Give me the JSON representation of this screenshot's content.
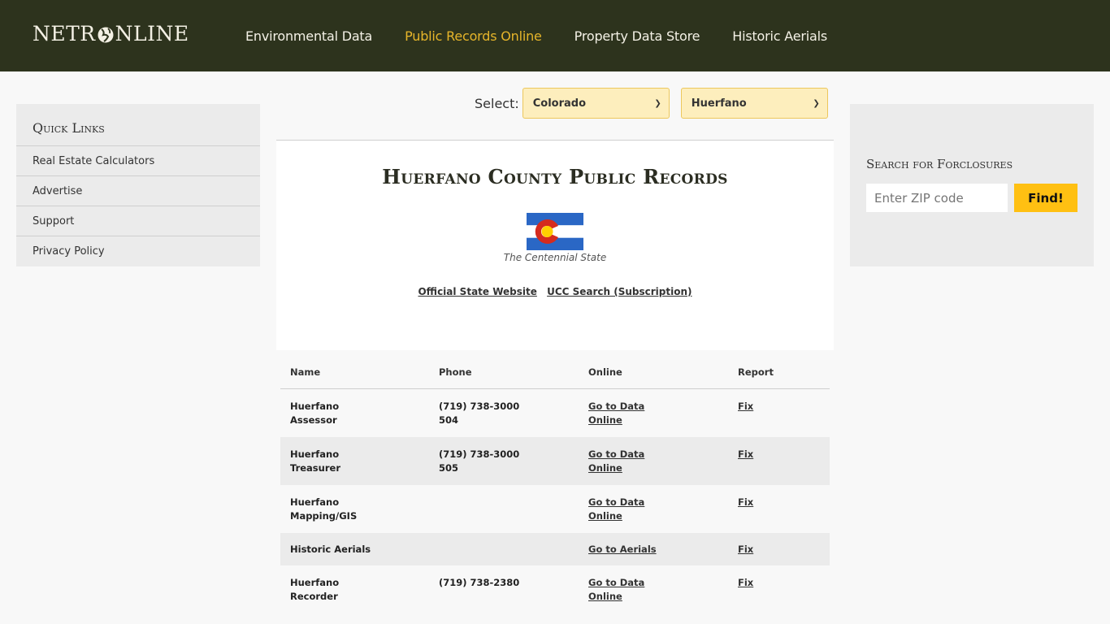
{
  "header": {
    "logo_left": "NETR",
    "logo_right": "NLINE",
    "nav": [
      {
        "label": "Environmental Data",
        "active": false
      },
      {
        "label": "Public Records Online",
        "active": true
      },
      {
        "label": "Property Data Store",
        "active": false
      },
      {
        "label": "Historic Aerials",
        "active": false
      }
    ]
  },
  "quick_links": {
    "title": "Quick Links",
    "items": [
      "Real Estate Calculators",
      "Advertise",
      "Support",
      "Privacy Policy"
    ]
  },
  "selector": {
    "label": "Select:",
    "state": "Colorado",
    "county": "Huerfano"
  },
  "panel": {
    "title": "Huerfano County Public Records",
    "flag_icon": "colorado-flag",
    "nickname": "The Centennial State",
    "links": [
      "Official State Website",
      "UCC Search (Subscription)"
    ]
  },
  "table": {
    "headers": [
      "Name",
      "Phone",
      "Online",
      "Report"
    ],
    "rows": [
      {
        "name": [
          "Huerfano",
          "Assessor"
        ],
        "phone": [
          "(719) 738-3000",
          "504"
        ],
        "online": [
          "Go to Data",
          "Online"
        ],
        "report": "Fix"
      },
      {
        "name": [
          "Huerfano",
          "Treasurer"
        ],
        "phone": [
          "(719) 738-3000",
          "505"
        ],
        "online": [
          "Go to Data",
          "Online"
        ],
        "report": "Fix"
      },
      {
        "name": [
          "Huerfano",
          "Mapping/GIS"
        ],
        "phone": [
          "",
          ""
        ],
        "online": [
          "Go to Data",
          "Online"
        ],
        "report": "Fix"
      },
      {
        "name": [
          "Historic Aerials",
          ""
        ],
        "phone": [
          "",
          ""
        ],
        "online": [
          "Go to Aerials",
          ""
        ],
        "report": "Fix"
      },
      {
        "name": [
          "Huerfano",
          "Recorder"
        ],
        "phone": [
          "(719) 738-2380",
          ""
        ],
        "online": [
          "Go to Data",
          "Online"
        ],
        "report": "Fix"
      }
    ]
  },
  "foreclosure": {
    "title": "Search for Forclosures",
    "placeholder": "Enter ZIP code",
    "button": "Find!"
  },
  "colors": {
    "header_bg": "#2d331d",
    "nav_active": "#e6b52a",
    "select_bg": "#fdeebd",
    "find_button": "#ffc012",
    "flag_blue": "#2a67c5",
    "flag_red": "#d52b1e",
    "flag_gold": "#ffd000"
  }
}
